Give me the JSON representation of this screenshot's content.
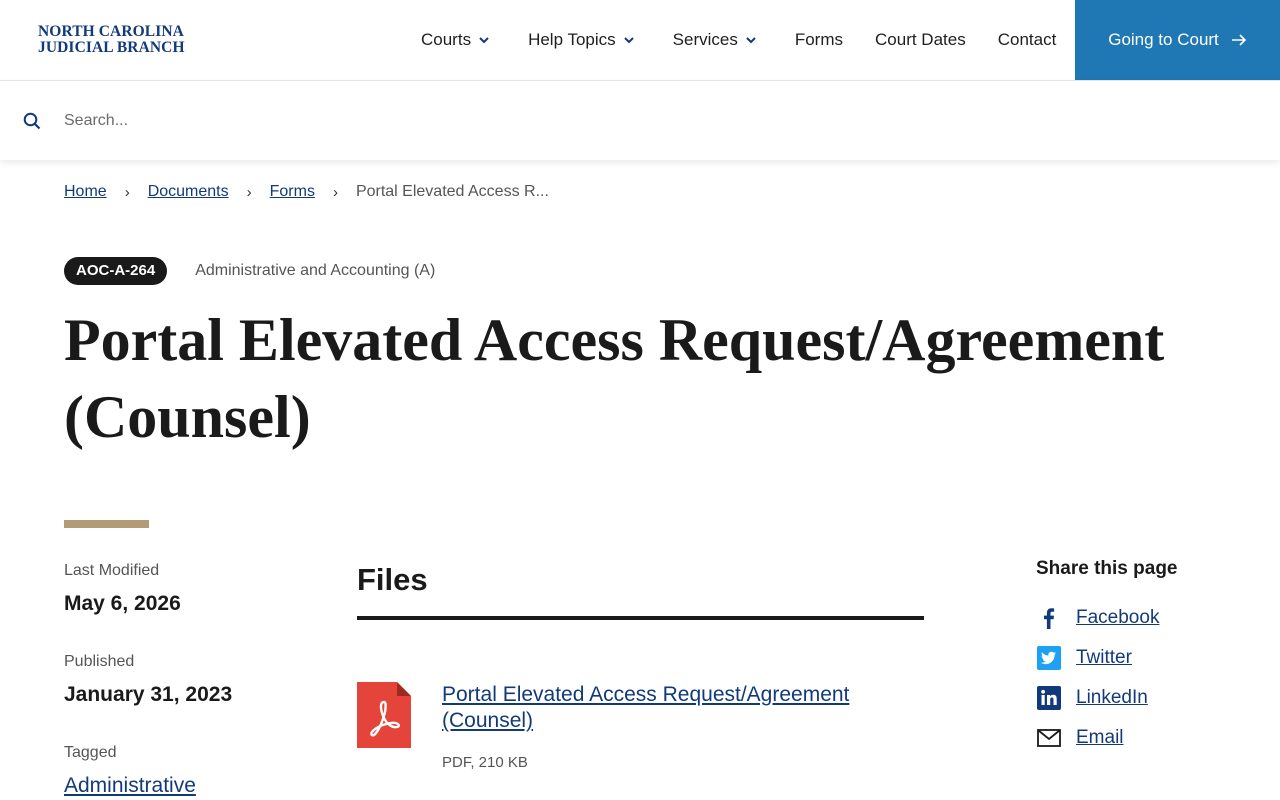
{
  "header": {
    "logo_line1": "NORTH CAROLINA",
    "logo_line2": "JUDICIAL BRANCH",
    "nav": {
      "courts": "Courts",
      "help_topics": "Help Topics",
      "services": "Services",
      "forms": "Forms",
      "court_dates": "Court Dates",
      "contact": "Contact"
    },
    "cta_label": "Going to Court"
  },
  "search": {
    "placeholder": "Search..."
  },
  "breadcrumb": {
    "home": "Home",
    "documents": "Documents",
    "forms": "Forms",
    "current": "Portal Elevated Access R..."
  },
  "document": {
    "code": "AOC-A-264",
    "category": "Administrative and Accounting (A)",
    "title": "Portal Elevated Access Request/Agreement (Counsel)"
  },
  "meta": {
    "last_modified_label": "Last Modified",
    "last_modified_value": "May 6, 2026",
    "published_label": "Published",
    "published_value": "January 31, 2023",
    "tagged_label": "Tagged",
    "tagged_value": "Administrative"
  },
  "files": {
    "heading": "Files",
    "items": [
      {
        "name": "Portal Elevated Access Request/Agreement (Counsel)",
        "info": "PDF, 210 KB"
      }
    ]
  },
  "share": {
    "title": "Share this page",
    "facebook": "Facebook",
    "twitter": "Twitter",
    "linkedin": "LinkedIn",
    "email": "Email"
  },
  "colors": {
    "brand_navy": "#123a7a",
    "cta_blue": "#1f78b4",
    "accent_tan": "#b39b77",
    "pdf_red": "#e5443a"
  },
  "icons": [
    "chevron-down-icon",
    "arrow-right-icon",
    "search-icon",
    "pdf-icon",
    "facebook-icon",
    "twitter-icon",
    "linkedin-icon",
    "email-icon"
  ]
}
